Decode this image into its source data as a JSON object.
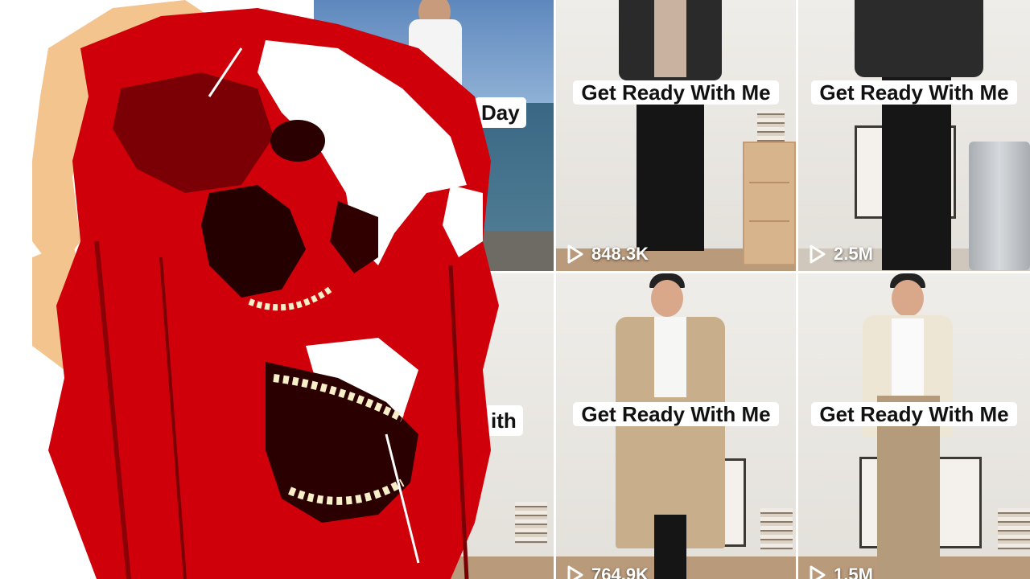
{
  "tiles": [
    {
      "id": "tile-beach",
      "caption": "Day",
      "views": ""
    },
    {
      "id": "tile-1",
      "caption": "Get Ready With Me",
      "views": "848.3K"
    },
    {
      "id": "tile-2",
      "caption": "Get Ready With Me",
      "views": "2.5M"
    },
    {
      "id": "tile-left-bottom",
      "caption": "ith",
      "views": ""
    },
    {
      "id": "tile-3",
      "caption": "Get Ready With Me",
      "views": "764.9K"
    },
    {
      "id": "tile-4",
      "caption": "Get Ready With Me",
      "views": "1.5M"
    }
  ],
  "icons": {
    "play": "play-icon"
  },
  "colors": {
    "overlay_red": "#d0000a",
    "overlay_dark": "#3a0000",
    "overlay_skin": "#f4c48f",
    "overlay_cream": "#f7efc8"
  }
}
